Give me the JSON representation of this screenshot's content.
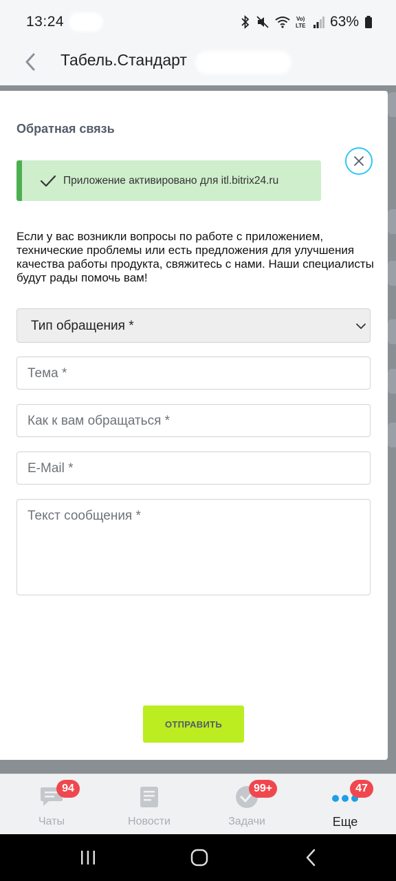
{
  "status_bar": {
    "time": "13:24",
    "battery": "63%",
    "icons": [
      "bluetooth-icon",
      "mute-icon",
      "wifi-icon",
      "volte-icon",
      "signal-icon",
      "battery-icon"
    ]
  },
  "app_bar": {
    "title": "Табель.Стандарт"
  },
  "modal": {
    "heading": "Обратная связь",
    "alert_text": "Приложение активировано для itl.bitrix24.ru",
    "description": "Если у вас возникли вопросы по работе с приложением, технические проблемы или есть предложения для улучшения качества работы продукта, свяжитесь с нами. Наши специалисты будут рады помочь вам!",
    "request_type_select": "Тип обращения *",
    "subject_placeholder": "Тема *",
    "name_placeholder": "Как к вам обращаться *",
    "email_placeholder": "E-Mail *",
    "message_placeholder": "Текст сообщения *",
    "submit_label": "ОТПРАВИТЬ"
  },
  "tab_bar": {
    "tabs": [
      {
        "label": "Чаты",
        "badge": "94",
        "icon": "chat-icon"
      },
      {
        "label": "Новости",
        "badge": "",
        "icon": "news-icon"
      },
      {
        "label": "Задачи",
        "badge": "99+",
        "icon": "tasks-icon"
      },
      {
        "label": "Еще",
        "badge": "47",
        "icon": "more-icon"
      }
    ],
    "active_tab": "Еще"
  },
  "colors": {
    "accent_cyan": "#2fc6f6",
    "submit_green": "#bbed21",
    "alert_green": "#4caf50",
    "badge_red": "#f0474e",
    "active_blue": "#1e9ee8"
  }
}
